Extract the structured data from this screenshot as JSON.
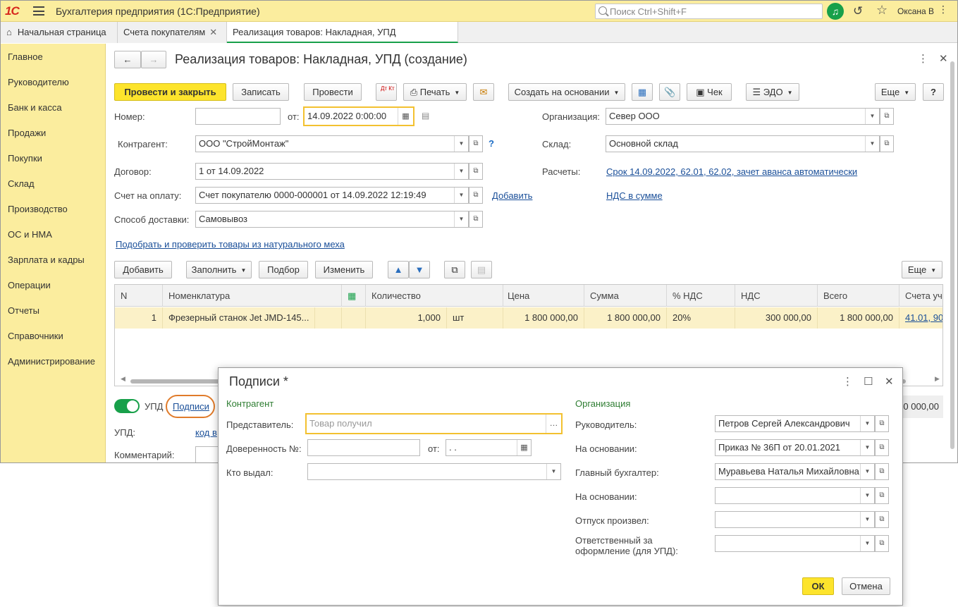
{
  "titlebar": {
    "logo": "1С",
    "app_title": "Бухгалтерия предприятия  (1С:Предприятие)",
    "search_placeholder": "Поиск Ctrl+Shift+F",
    "user": "Оксана В"
  },
  "tabs": [
    {
      "label": "Начальная страница"
    },
    {
      "label": "Счета покупателям"
    },
    {
      "label": "Реализация товаров: Накладная, УПД (создание)"
    }
  ],
  "sidebar": {
    "items": [
      {
        "label": "Главное"
      },
      {
        "label": "Руководителю"
      },
      {
        "label": "Банк и касса"
      },
      {
        "label": "Продажи"
      },
      {
        "label": "Покупки"
      },
      {
        "label": "Склад"
      },
      {
        "label": "Производство"
      },
      {
        "label": "ОС и НМА"
      },
      {
        "label": "Зарплата и кадры"
      },
      {
        "label": "Операции"
      },
      {
        "label": "Отчеты"
      },
      {
        "label": "Справочники"
      },
      {
        "label": "Администрирование"
      }
    ]
  },
  "form": {
    "title": "Реализация товаров: Накладная, УПД (создание)",
    "toolbar": {
      "post_close": "Провести и закрыть",
      "save": "Записать",
      "post": "Провести",
      "dtkt": "Дт Кт",
      "print": "Печать",
      "create_based": "Создать на основании",
      "check": "Чек",
      "edo": "ЭДО",
      "more": "Еще",
      "help": "?"
    },
    "number_label": "Номер:",
    "number_value": "",
    "from_label": "от:",
    "date_value": "14.09.2022  0:00:00",
    "org_label": "Организация:",
    "org_value": "Север ООО",
    "counterparty_label": "Контрагент:",
    "counterparty_value": "ООО \"СтройМонтаж\"",
    "warehouse_label": "Склад:",
    "warehouse_value": "Основной склад",
    "contract_label": "Договор:",
    "contract_value": "1 от 14.09.2022",
    "settlements_label": "Расчеты:",
    "settlements_link": "Срок 14.09.2022, 62.01, 62.02, зачет аванса автоматически",
    "invoice_label": "Счет на оплату:",
    "invoice_value": "Счет покупателю 0000-000001 от 14.09.2022 12:19:49",
    "add_link": "Добавить",
    "vat_link": "НДС в сумме",
    "delivery_label": "Способ доставки:",
    "delivery_value": "Самовывоз",
    "fur_link": "Подобрать и проверить товары из натурального меха",
    "table_toolbar": {
      "add": "Добавить",
      "fill": "Заполнить",
      "pick": "Подбор",
      "change": "Изменить",
      "more": "Еще"
    },
    "table": {
      "columns": [
        "N",
        "Номенклатура",
        "",
        "Количество",
        "",
        "Цена",
        "Сумма",
        "% НДС",
        "НДС",
        "Всего",
        "Счета уч"
      ],
      "rows": [
        {
          "n": "1",
          "item": "Фрезерный станок Jet JMD-145...",
          "qty": "1,000",
          "unit": "шт",
          "price": "1 800 000,00",
          "sum": "1 800 000,00",
          "vat_rate": "20%",
          "vat": "300 000,00",
          "total": "1 800 000,00",
          "accounts": "41.01, 90"
        }
      ]
    },
    "upd_toggle_label": "УПД",
    "signatures_link": "Подписи",
    "upd_label": "УПД:",
    "upd_code_link": "код в",
    "comment_label": "Комментарий:",
    "total_right": "0 000,00"
  },
  "dialog": {
    "title": "Подписи *",
    "counterparty_section": "Контрагент",
    "representative_label": "Представитель:",
    "representative_placeholder": "Товар получил",
    "poa_label": "Доверенность №:",
    "poa_from_label": "от:",
    "poa_date": " .  .",
    "issued_by_label": "Кто выдал:",
    "org_section": "Организация",
    "head_label": "Руководитель:",
    "head_value": "Петров Сергей Александрович",
    "basis1_label": "На основании:",
    "basis1_value": "Приказ № 36П от 20.01.2021",
    "chief_acc_label": "Главный бухгалтер:",
    "chief_acc_value": "Муравьева Наталья Михайловна",
    "basis2_label": "На основании:",
    "basis2_value": "",
    "released_label": "Отпуск произвел:",
    "released_value": "",
    "responsible_label": "Ответственный за оформление (для УПД):",
    "responsible_value": "",
    "ok": "ОК",
    "cancel": "Отмена"
  }
}
